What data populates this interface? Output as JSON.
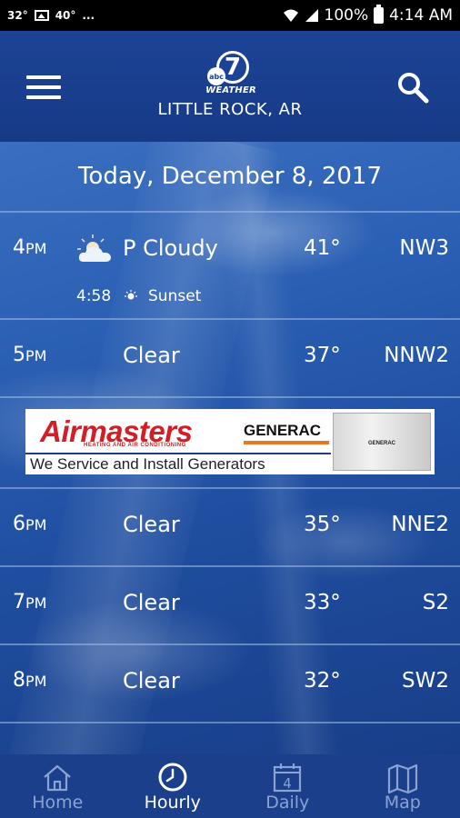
{
  "status_bar": {
    "temp1": "32°",
    "temp2": "40°",
    "more": "...",
    "battery": "100%",
    "time": "4:14 AM"
  },
  "header": {
    "logo_number": "7",
    "logo_network": "abc",
    "logo_text": "WEATHER",
    "location": "LITTLE ROCK, AR"
  },
  "date": "Today, December 8, 2017",
  "hours": [
    {
      "hour": "4",
      "ampm": "PM",
      "icon": "partly-cloudy-icon",
      "condition": "P Cloudy",
      "temp": "41°",
      "wind": "NW3"
    },
    {
      "hour": "5",
      "ampm": "PM",
      "icon": "moon-icon",
      "condition": "Clear",
      "temp": "37°",
      "wind": "NNW2"
    },
    {
      "hour": "6",
      "ampm": "PM",
      "icon": "moon-icon",
      "condition": "Clear",
      "temp": "35°",
      "wind": "NNE2"
    },
    {
      "hour": "7",
      "ampm": "PM",
      "icon": "moon-icon",
      "condition": "Clear",
      "temp": "33°",
      "wind": "S2"
    },
    {
      "hour": "8",
      "ampm": "PM",
      "icon": "moon-icon",
      "condition": "Clear",
      "temp": "32°",
      "wind": "SW2"
    }
  ],
  "sunset": {
    "time": "4:58",
    "label": "Sunset"
  },
  "ad": {
    "brand": "Airmasters",
    "sub": "HEATING AND AIR CONDITIONING",
    "partner": "GENERAC",
    "product_label": "GENERAC",
    "tagline": "We Service and Install Generators"
  },
  "tabs": [
    {
      "label": "Home",
      "icon": "home-icon"
    },
    {
      "label": "Hourly",
      "icon": "clock-icon"
    },
    {
      "label": "Daily",
      "icon": "calendar-icon",
      "badge": "4"
    },
    {
      "label": "Map",
      "icon": "map-icon"
    }
  ],
  "active_tab": "Hourly",
  "colors": {
    "header_bg": "#1c4396",
    "ad_red": "#d21e24",
    "ad_orange": "#e87722",
    "tab_inactive": "#8aa3d2"
  }
}
